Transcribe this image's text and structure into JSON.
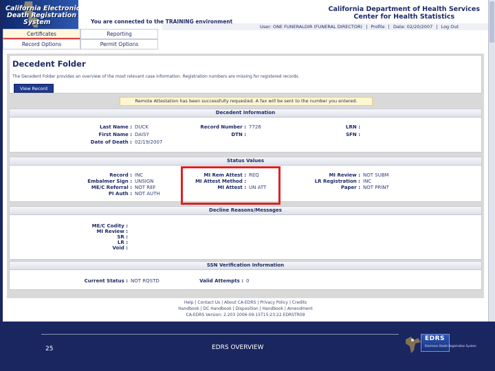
{
  "header": {
    "logo_lines": [
      "California Electronic",
      "Death Registration",
      "System"
    ],
    "training_message": "You are connected to the TRAINING environment",
    "dept_name": "California Department of Health Services",
    "dept_sub": "Center for Health Statistics",
    "user_bar": {
      "user": "User: ONE FUNERALDIR (FUNERAL DIRECTOR)",
      "sep": "|",
      "profile": "Profile",
      "date": "Date: 02/20/2007",
      "logout": "Log Out"
    }
  },
  "menu": {
    "row1": [
      "Certificates",
      "Reporting"
    ],
    "row2": [
      "Record Options",
      "Permit Options"
    ]
  },
  "folder": {
    "title": "Decedent Folder",
    "description": "The Decedent Folder provides an overview of the most relevant case information. Registration numbers are missing for registered records.",
    "view_record_button": "View Record"
  },
  "notice": "Remote Attestation has been successfully requested. A fax will be sent to the number you entered.",
  "decedent_info": {
    "heading": "Decedent Information",
    "last_name_label": "Last Name :",
    "last_name": "DUCK",
    "first_name_label": "First Name :",
    "first_name": "DAISY",
    "dod_label": "Date of Death :",
    "dod": "02/19/2007",
    "record_number_label": "Record Number :",
    "record_number": "7726",
    "dtn_label": "DTN :",
    "dtn": "",
    "lrn_label": "LRN :",
    "lrn": "",
    "sfn_label": "SFN :",
    "sfn": ""
  },
  "status_values": {
    "heading": "Status Values",
    "record_label": "Record :",
    "record": "INC",
    "embalmer_label": "Embalmer Sign :",
    "embalmer": "UNSIGN",
    "mec_label": "ME/C Referral :",
    "mec": "NOT REF",
    "pi_auth_label": "PI Auth :",
    "pi_auth": "NOT AUTH",
    "mi_rem_label": "MI Rem Attest :",
    "mi_rem": "REQ",
    "mi_method_label": "MI Attest Method :",
    "mi_method": "",
    "mi_attest_label": "MI Attest :",
    "mi_attest": "UN ATT",
    "mi_review_label": "MI Review :",
    "mi_review": "NOT SUBM",
    "lr_reg_label": "LR Registration :",
    "lr_reg": "INC",
    "paper_label": "Paper :",
    "paper": "NOT PRINT"
  },
  "decline": {
    "heading": "Decline Reasons/Messages",
    "labels": [
      "ME/C Codity :",
      "MI Review :",
      "SR :",
      "LR :",
      "Void :"
    ]
  },
  "ssn": {
    "heading": "SSN Verification Information",
    "current_status_label": "Current Status :",
    "current_status": "NOT RQSTD",
    "valid_attempts_label": "Valid Attempts :",
    "valid_attempts": "0"
  },
  "app_footer": {
    "line1": "Help | Contact Us | About CA-EDRS | Privacy Policy | Credits",
    "line2": "Handbook | DC Handbook | Disposition | Handbook | Amendment",
    "line3": "CA-EDRS Version: 2.203 2006-09-15T15:23:22 EDRSTR09"
  },
  "slide": {
    "page_number": "25",
    "title": "EDRS OVERVIEW",
    "logo_text": "EDRS",
    "logo_sub": "Electronic Death Registration System"
  }
}
